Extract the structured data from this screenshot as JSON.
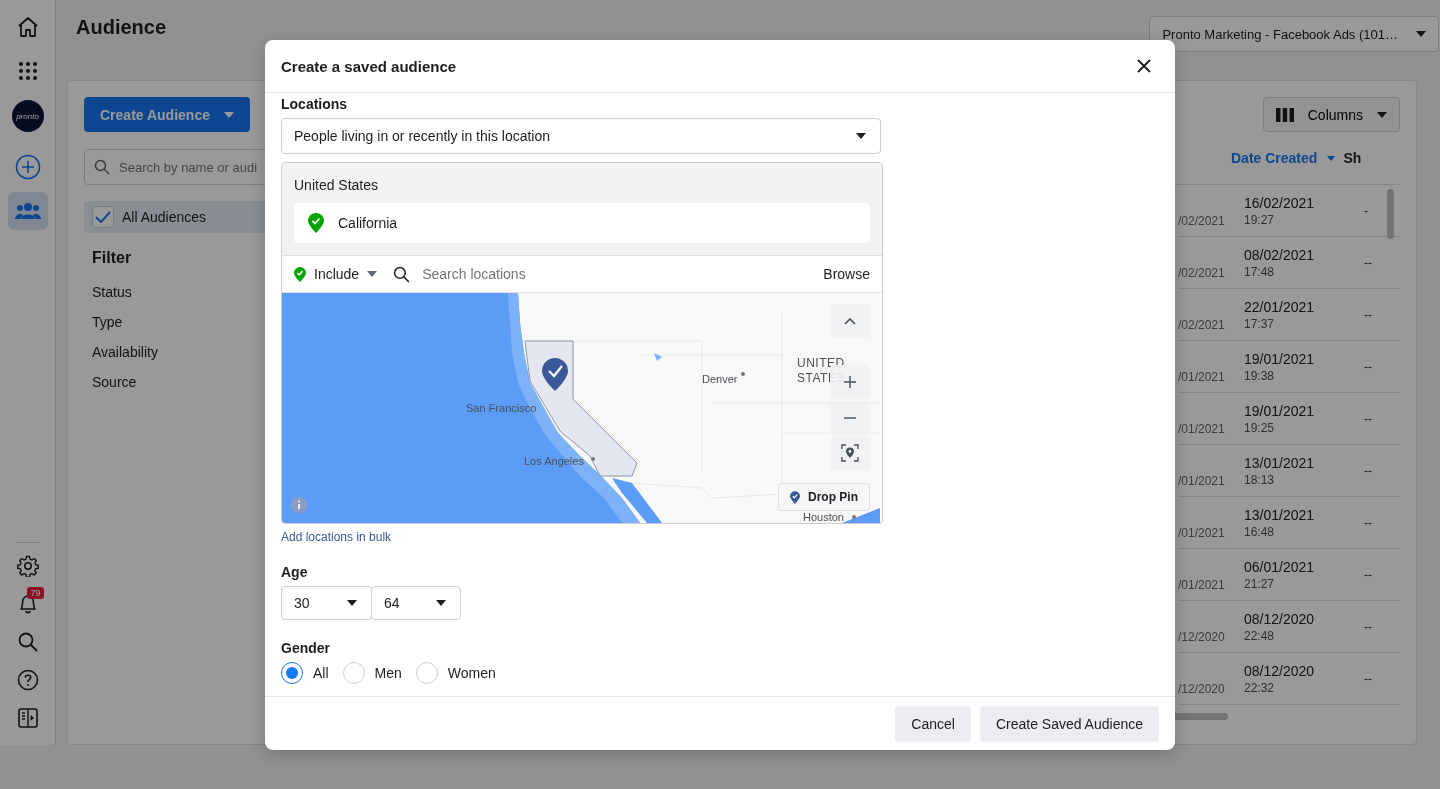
{
  "nav": {
    "top": [
      {
        "kind": "home",
        "selected": false
      },
      {
        "kind": "apps",
        "selected": false
      },
      {
        "kind": "avatar",
        "label": "pronto"
      },
      {
        "kind": "create",
        "selected": false
      },
      {
        "kind": "audiences",
        "selected": true
      }
    ],
    "bottom": [
      {
        "kind": "settings"
      },
      {
        "kind": "notifications",
        "badge": "79"
      },
      {
        "kind": "search"
      },
      {
        "kind": "help"
      },
      {
        "kind": "panel"
      }
    ]
  },
  "page": {
    "title": "Audience",
    "account": "Pronto Marketing - Facebook Ads (101…"
  },
  "sidebar": {
    "create_button": "Create Audience",
    "search_placeholder": "Search by name or audi",
    "all_audiences": {
      "label": "All Audiences",
      "checked": true
    },
    "filter_title": "Filter",
    "filters": [
      "Status",
      "Type",
      "Availability",
      "Source"
    ]
  },
  "table": {
    "columns_button": "Columns",
    "columns": [
      "Date Created",
      "Sh"
    ],
    "rows": [
      {
        "column_1": "/02/2021",
        "date": "16/02/2021",
        "time": "19:27",
        "column_3": "-"
      },
      {
        "column_1": "/02/2021",
        "date": "08/02/2021",
        "time": "17:48",
        "column_3": "--"
      },
      {
        "column_1": "/02/2021",
        "date": "22/01/2021",
        "time": "17:37",
        "column_3": "--"
      },
      {
        "column_1": "/01/2021",
        "date": "19/01/2021",
        "time": "19:38",
        "column_3": "--"
      },
      {
        "column_1": "/01/2021",
        "date": "19/01/2021",
        "time": "19:25",
        "column_3": "--"
      },
      {
        "column_1": "/01/2021",
        "date": "13/01/2021",
        "time": "18:13",
        "column_3": "--"
      },
      {
        "column_1": "/01/2021",
        "date": "13/01/2021",
        "time": "16:48",
        "column_3": "--"
      },
      {
        "column_1": "/01/2021",
        "date": "06/01/2021",
        "time": "21:27",
        "column_3": "--"
      },
      {
        "column_1": "/12/2020",
        "date": "08/12/2020",
        "time": "22:48",
        "column_3": "--"
      },
      {
        "column_1": "/12/2020",
        "date": "08/12/2020",
        "time": "22:32",
        "column_3": "--"
      }
    ]
  },
  "dialog": {
    "title": "Create a saved audience",
    "locations": {
      "label": "Locations",
      "mode": "People living in or recently in this location",
      "country": "United States",
      "selected_locations": [
        "California"
      ],
      "include": "Include",
      "search_placeholder": "Search locations",
      "browse": "Browse",
      "bulk_link": "Add locations in bulk",
      "map": {
        "labels": [
          {
            "text": "San Francisco",
            "kind": "city"
          },
          {
            "text": "Los Angeles",
            "kind": "city"
          },
          {
            "text": "Denver",
            "kind": "city"
          },
          {
            "text": "UNITED",
            "kind": "country"
          },
          {
            "text": "STATES",
            "kind": "country"
          },
          {
            "text": "Houston",
            "kind": "city"
          }
        ],
        "drop_pin": "Drop Pin"
      }
    },
    "age": {
      "label": "Age",
      "min": "30",
      "max": "64"
    },
    "gender": {
      "label": "Gender",
      "options": [
        {
          "label": "All",
          "selected": true
        },
        {
          "label": "Men",
          "selected": false
        },
        {
          "label": "Women",
          "selected": false
        }
      ]
    },
    "buttons": [
      "Cancel",
      "Create Saved Audience"
    ]
  }
}
